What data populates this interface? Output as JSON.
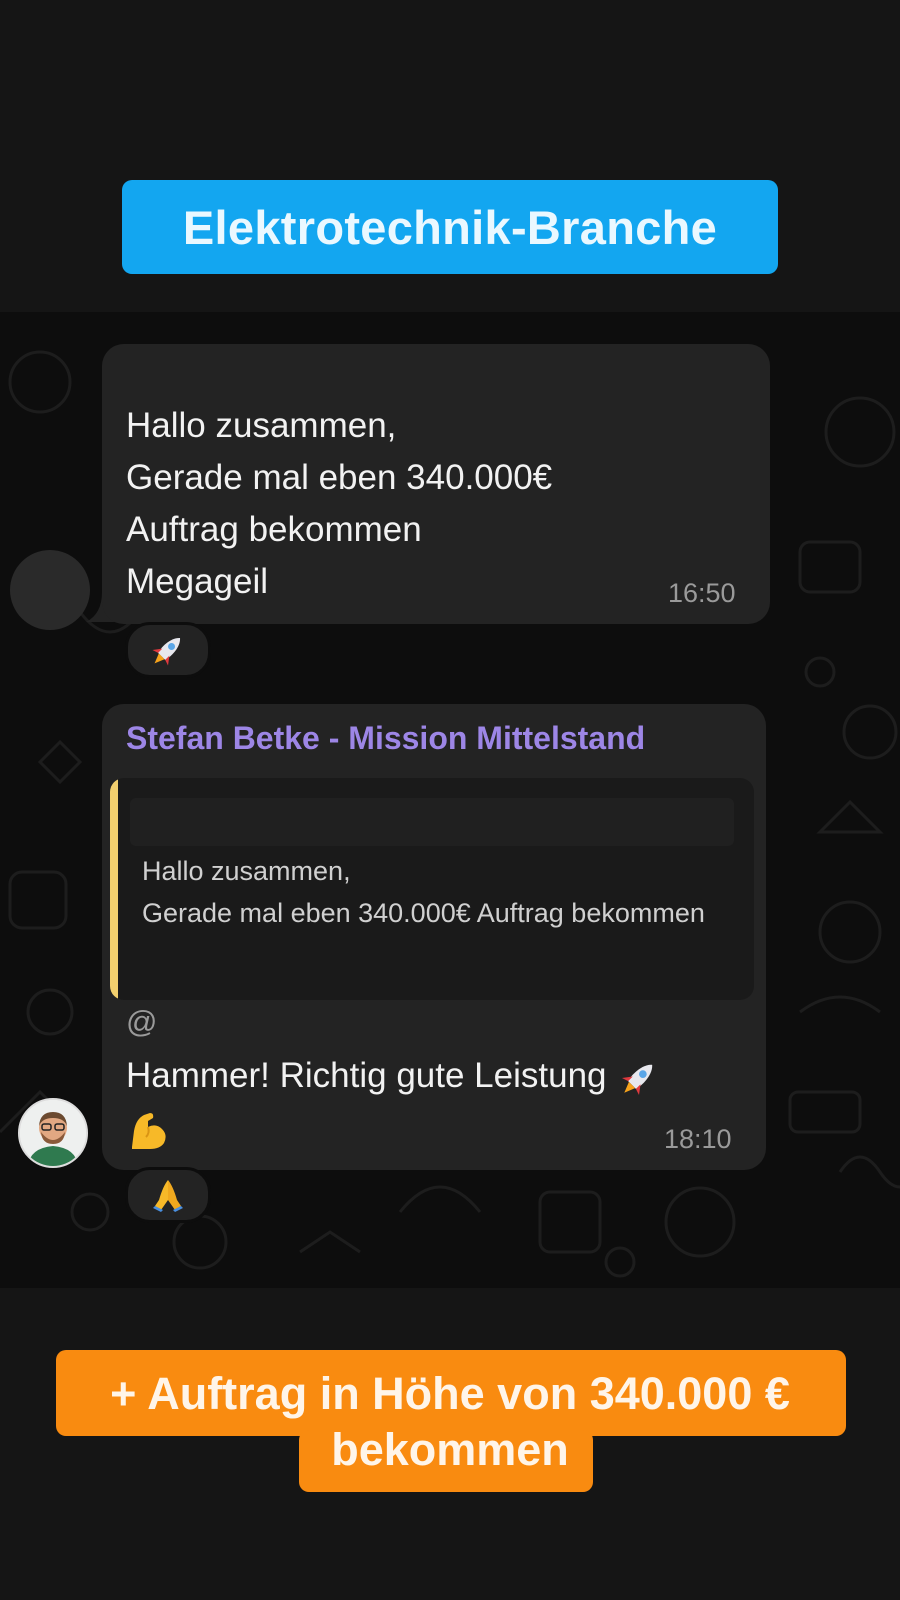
{
  "header": {
    "banner": "Elektrotechnik-Branche"
  },
  "messages": [
    {
      "text": "Hallo zusammen,\nGerade mal eben 340.000€\nAuftrag bekommen\nMegageil",
      "time": "16:50",
      "reaction": "rocket-icon"
    },
    {
      "sender": "Stefan Betke - Mission Mittelstand",
      "quote": "Hallo zusammen,\nGerade mal eben 340.000€  Auftrag bekommen",
      "mention": "@",
      "text": "Hammer! Richtig gute Leistung",
      "inline_icons": [
        "rocket-icon",
        "flexed-biceps-icon"
      ],
      "time": "18:10",
      "reaction": "folded-hands-icon"
    }
  ],
  "footer": {
    "banner": "+ Auftrag in Höhe von 340.000 €\nbekommen"
  },
  "colors": {
    "top_banner": "#13a6f0",
    "bottom_banner": "#f98b10",
    "sender_name": "#9d86e6",
    "quote_bar": "#f2cf6e",
    "bubble": "#232323"
  }
}
